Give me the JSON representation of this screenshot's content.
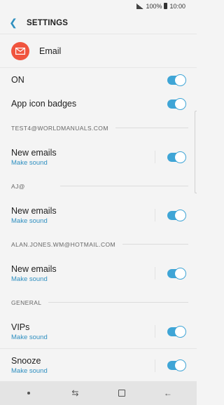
{
  "status_bar": {
    "battery": "100%",
    "time": "10:00"
  },
  "header": {
    "title": "SETTINGS"
  },
  "app": {
    "name": "Email"
  },
  "toggles": {
    "on": {
      "label": "ON",
      "state": true
    },
    "badges": {
      "label": "App icon badges",
      "state": true
    }
  },
  "accounts": [
    {
      "section": "TEST4@WORLDMANUALS.COM",
      "label": "New emails",
      "sub": "Make sound",
      "state": true
    },
    {
      "section": "AJ@",
      "label": "New emails",
      "sub": "Make sound",
      "state": true
    },
    {
      "section": "ALAN.JONES.WM@HOTMAIL.COM",
      "label": "New emails",
      "sub": "Make sound",
      "state": true
    }
  ],
  "general": {
    "section": "GENERAL",
    "vips": {
      "label": "VIPs",
      "sub": "Make sound",
      "state": true
    },
    "snooze": {
      "label": "Snooze",
      "sub": "Make sound",
      "state": true
    }
  },
  "colors": {
    "accent": "#3fa5d6",
    "app_icon": "#f0543e",
    "link": "#2f8fc0"
  }
}
